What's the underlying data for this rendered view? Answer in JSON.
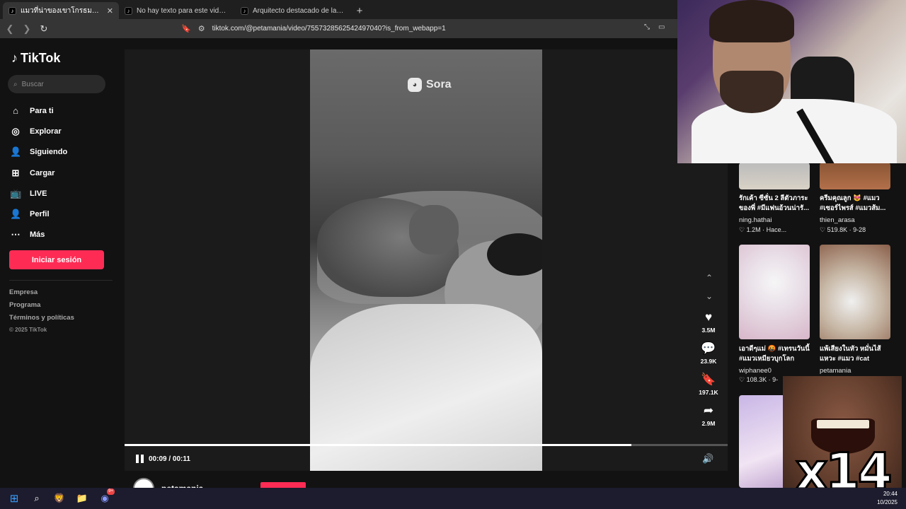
{
  "browser": {
    "tabs": [
      {
        "title": "แมวที่น่าของเขาโกรธมาไล่พ่อ | TikTok",
        "active": true
      },
      {
        "title": "No hay texto para este video #gym |",
        "active": false
      },
      {
        "title": "Arquitecto destacado de la UCV en P",
        "active": false
      }
    ],
    "url": "tiktok.com/@petamania/video/7557328562542497040?is_from_webapp=1"
  },
  "sidebar": {
    "brand": "TikTok",
    "search_placeholder": "Buscar",
    "items": [
      {
        "label": "Para ti",
        "icon": "home-icon"
      },
      {
        "label": "Explorar",
        "icon": "compass-icon"
      },
      {
        "label": "Siguiendo",
        "icon": "following-icon"
      },
      {
        "label": "Cargar",
        "icon": "upload-icon"
      },
      {
        "label": "LIVE",
        "icon": "live-icon"
      },
      {
        "label": "Perfil",
        "icon": "profile-icon"
      },
      {
        "label": "Más",
        "icon": "more-icon"
      }
    ],
    "login_label": "Iniciar sesión",
    "footer_links": [
      "Empresa",
      "Programa",
      "Términos y políticas"
    ],
    "copyright": "© 2025 TikTok"
  },
  "video": {
    "watermark": "Sora",
    "time": "00:09 / 00:11",
    "progress": 0.84,
    "author": "petamania",
    "actions": [
      {
        "name": "like",
        "count": "3.5M",
        "icon": "heart-icon"
      },
      {
        "name": "comment",
        "count": "23.9K",
        "icon": "comment-icon"
      },
      {
        "name": "save",
        "count": "197.1K",
        "icon": "bookmark-icon"
      },
      {
        "name": "share",
        "count": "2.9M",
        "icon": "share-icon"
      }
    ]
  },
  "grid": [
    {
      "caption": "รักเค้า ซีซั่น 2 ลีตัวภาระของพี่ #มีแฟนอ้วนน่ารั...",
      "user": "ning.hathai",
      "meta": "1.2M · Hace..."
    },
    {
      "caption": "ครีมคุณลูก 😻 #แมว #เซอร์ไพรส์ #แมวส้ม...",
      "user": "thien_arasa",
      "meta": "519.8K · 9-28"
    },
    {
      "caption": "เอาดีๆแม่ 🤬 #เทรนวันนี้ #แมวเหมียวบุกโลก",
      "user": "wiphanee0",
      "meta": "108.3K · 9-"
    },
    {
      "caption": "แพ้เสียงในหัว หมั่นไส้แหวะ #แมว #cat",
      "user": "petamania",
      "meta": ""
    }
  ],
  "meme_text": "x14",
  "taskbar": {
    "clock_time": "20:44",
    "clock_date": "10/2025"
  }
}
